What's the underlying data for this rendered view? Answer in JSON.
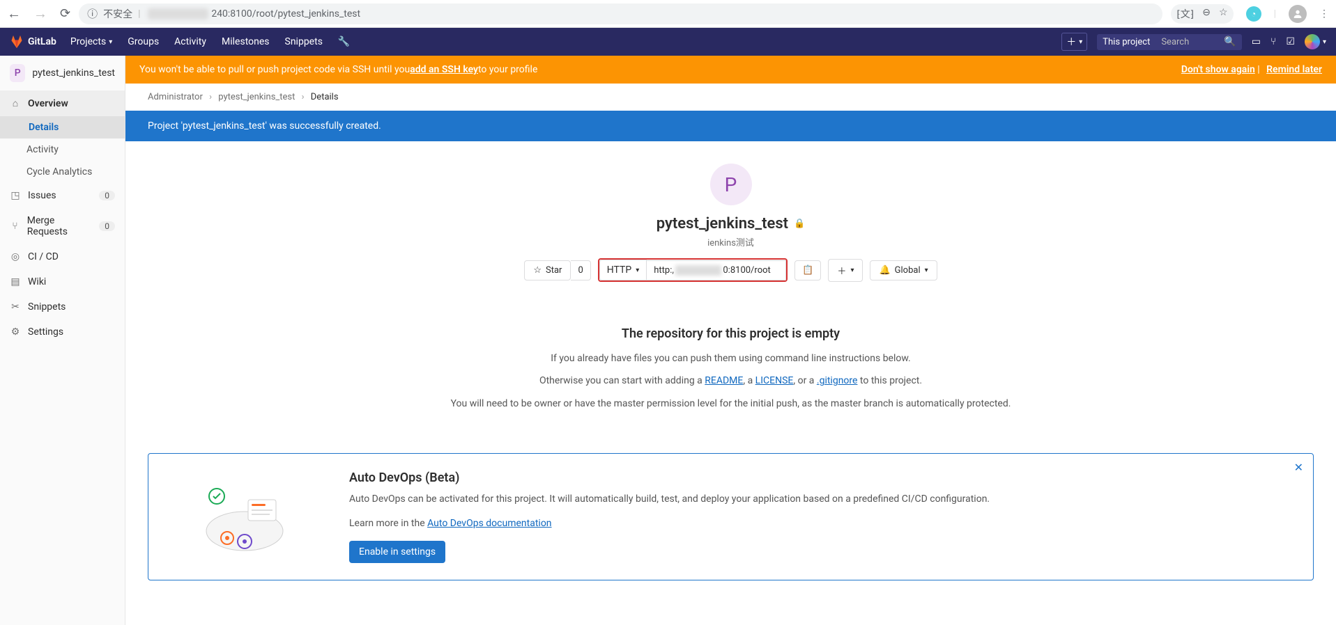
{
  "browser": {
    "insecure_label": "不安全",
    "url_suffix": "240:8100/root/pytest_jenkins_test"
  },
  "gitlab": {
    "brand": "GitLab",
    "nav": {
      "projects": "Projects",
      "groups": "Groups",
      "activity": "Activity",
      "milestones": "Milestones",
      "snippets": "Snippets"
    },
    "search_scope": "This project",
    "search_placeholder": "Search"
  },
  "sidebar": {
    "project_letter": "P",
    "project_name": "pytest_jenkins_test",
    "overview": "Overview",
    "details": "Details",
    "activity": "Activity",
    "cycle_analytics": "Cycle Analytics",
    "issues": "Issues",
    "issues_count": "0",
    "merge_requests": "Merge Requests",
    "mr_count": "0",
    "cicd": "CI / CD",
    "wiki": "Wiki",
    "snippets": "Snippets",
    "settings": "Settings"
  },
  "banner": {
    "ssh_prefix": "You won't be able to pull or push project code via SSH until you ",
    "ssh_link": "add an SSH key",
    "ssh_suffix": " to your profile",
    "dont_show": "Don't show again",
    "remind": "Remind later"
  },
  "breadcrumbs": {
    "a": "Administrator",
    "b": "pytest_jenkins_test",
    "c": "Details"
  },
  "flash": {
    "created": "Project 'pytest_jenkins_test' was successfully created."
  },
  "project": {
    "letter": "P",
    "name": "pytest_jenkins_test",
    "desc": "ienkins测试",
    "star_label": "Star",
    "star_count": "0",
    "proto": "HTTP",
    "url_prefix": "http:,",
    "url_suffix": "0:8100/root",
    "global": "Global"
  },
  "empty": {
    "heading": "The repository for this project is empty",
    "p1": "If you already have files you can push them using command line instructions below.",
    "p2_pre": "Otherwise you can start with adding a ",
    "readme": "README",
    "p2_mid1": ", a ",
    "license": "LICENSE",
    "p2_mid2": ", or a ",
    "gitignore": ".gitignore",
    "p2_post": " to this project.",
    "p3": "You will need to be owner or have the master permission level for the initial push, as the master branch is automatically protected."
  },
  "devops": {
    "title": "Auto DevOps (Beta)",
    "body": "Auto DevOps can be activated for this project. It will automatically build, test, and deploy your application based on a predefined CI/CD configuration.",
    "learn_pre": "Learn more in the ",
    "learn_link": "Auto DevOps documentation",
    "enable": "Enable in settings"
  }
}
